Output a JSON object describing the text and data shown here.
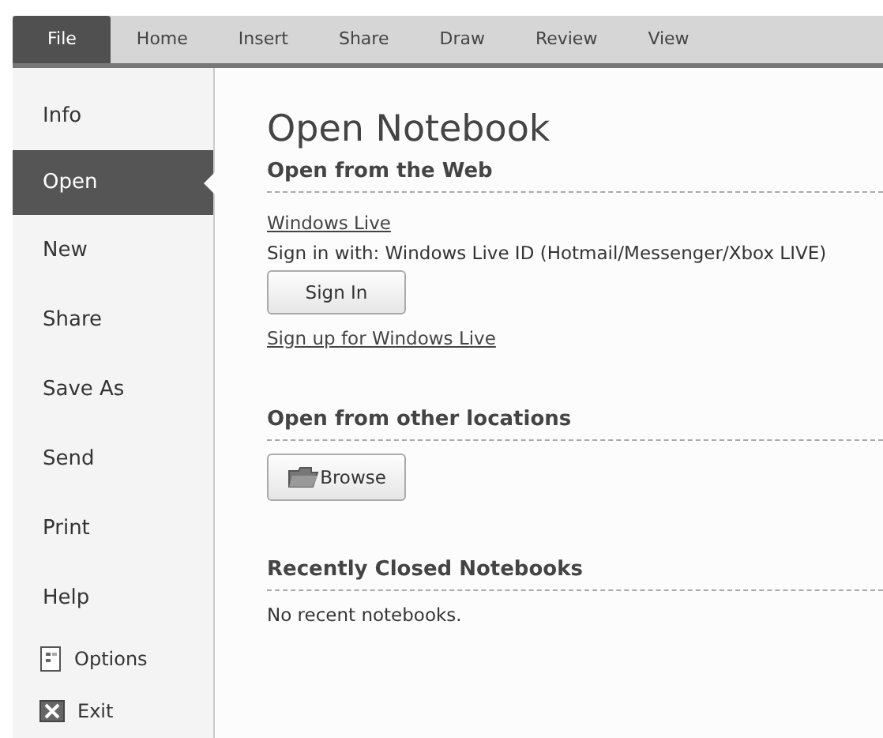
{
  "tabs": [
    {
      "label": "File",
      "selected": true
    },
    {
      "label": "Home",
      "selected": false
    },
    {
      "label": "Insert",
      "selected": false
    },
    {
      "label": "Share",
      "selected": false
    },
    {
      "label": "Draw",
      "selected": false
    },
    {
      "label": "Review",
      "selected": false
    },
    {
      "label": "View",
      "selected": false
    }
  ],
  "sidebar": {
    "items": [
      {
        "label": "Info",
        "kind": "text",
        "selected": false
      },
      {
        "label": "Open",
        "kind": "text",
        "selected": true
      },
      {
        "label": "New",
        "kind": "text",
        "selected": false
      },
      {
        "label": "Share",
        "kind": "text",
        "selected": false
      },
      {
        "label": "Save As",
        "kind": "text",
        "selected": false
      },
      {
        "label": "Send",
        "kind": "text",
        "selected": false
      },
      {
        "label": "Print",
        "kind": "text",
        "selected": false
      },
      {
        "label": "Help",
        "kind": "text",
        "selected": false
      },
      {
        "label": "Options",
        "kind": "options",
        "selected": false
      },
      {
        "label": "Exit",
        "kind": "exit",
        "selected": false
      }
    ]
  },
  "main": {
    "title": "Open Notebook",
    "sections": [
      {
        "heading": "Open from the Web",
        "items": [
          {
            "kind": "link",
            "text": "Windows Live"
          },
          {
            "kind": "text",
            "text": "Sign in with: Windows Live ID (Hotmail/Messenger/Xbox LIVE)"
          },
          {
            "kind": "button",
            "text": "Sign In"
          },
          {
            "kind": "link",
            "text": "Sign up for Windows Live"
          }
        ]
      },
      {
        "heading": "Open from other locations",
        "items": [
          {
            "kind": "browse",
            "text": "Browse"
          }
        ]
      },
      {
        "heading": "Recently Closed Notebooks",
        "items": [
          {
            "kind": "text",
            "text": "No recent notebooks."
          }
        ]
      }
    ]
  }
}
